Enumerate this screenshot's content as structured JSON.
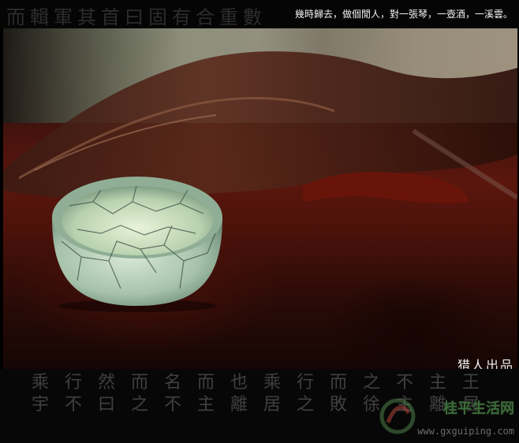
{
  "top": {
    "caption": "幾時歸去，做個閒人，對一張琴，一壺酒，一溪雲。",
    "calligraphy": "而輯軍其首曰固有合重數"
  },
  "photo": {
    "signature": "猎人出品"
  },
  "bottom": {
    "calligraphy": [
      "乘",
      "行",
      "然",
      "而",
      "名",
      "而",
      "也",
      "乘",
      "行",
      "而",
      "之",
      "不",
      "主",
      "王",
      "宇",
      "不",
      "曰",
      "之",
      "不",
      "主",
      "離",
      "居",
      "之",
      "敗",
      "徐",
      "主",
      "離",
      "居"
    ]
  },
  "watermark": {
    "site_name": "桂平生活网",
    "url": "www.gxguiping.com"
  },
  "colors": {
    "wood_dark": "#2a0b07",
    "wood_red": "#5a160d",
    "celadon": "#a9c6ad"
  }
}
